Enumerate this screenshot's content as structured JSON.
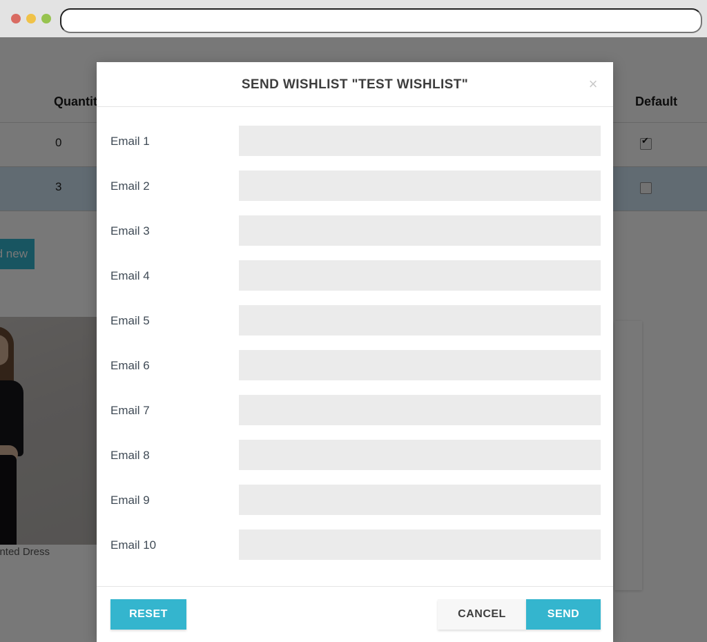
{
  "browser": {
    "url_value": "",
    "url_placeholder": "",
    "traffic_lights": [
      "close",
      "minimize",
      "maximize"
    ]
  },
  "background_page": {
    "table": {
      "columns": [
        "Quantity",
        "Default"
      ],
      "rows": [
        {
          "quantity": "0",
          "default_checked": true
        },
        {
          "quantity": "3",
          "default_checked": false
        }
      ]
    },
    "wishlist_button_label": "Add new wishlist",
    "delete_icon": "trash-icon",
    "product_caption": "Printed Dress"
  },
  "modal": {
    "title": "SEND WISHLIST \"TEST WISHLIST\"",
    "close_label": "×",
    "fields": [
      {
        "label": "Email 1",
        "value": "",
        "placeholder": ""
      },
      {
        "label": "Email 2",
        "value": "",
        "placeholder": ""
      },
      {
        "label": "Email 3",
        "value": "",
        "placeholder": ""
      },
      {
        "label": "Email 4",
        "value": "",
        "placeholder": ""
      },
      {
        "label": "Email 5",
        "value": "",
        "placeholder": ""
      },
      {
        "label": "Email 6",
        "value": "",
        "placeholder": ""
      },
      {
        "label": "Email 7",
        "value": "",
        "placeholder": ""
      },
      {
        "label": "Email 8",
        "value": "",
        "placeholder": ""
      },
      {
        "label": "Email 9",
        "value": "",
        "placeholder": ""
      },
      {
        "label": "Email 10",
        "value": "",
        "placeholder": ""
      }
    ],
    "footer": {
      "reset_label": "RESET",
      "cancel_label": "CANCEL",
      "send_label": "SEND"
    }
  },
  "colors": {
    "accent_teal": "#34b5ce",
    "input_gray": "#ebebeb",
    "overlay": "rgba(0,0,0,0.53)",
    "chrome_gray": "#e3e3e3",
    "cancel_gray": "#f7f7f7"
  }
}
